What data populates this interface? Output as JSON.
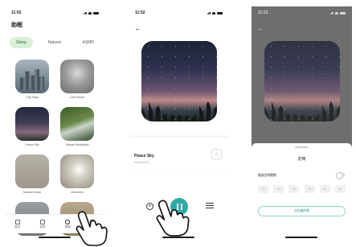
{
  "status": {
    "time": "11:52"
  },
  "screen1": {
    "title": "助眠",
    "tabs": [
      "Sleep",
      "Natural",
      "ASMR"
    ],
    "items": [
      {
        "caption": "City Stray"
      },
      {
        "caption": "Lost Dream"
      },
      {
        "caption": "Peace Sky"
      },
      {
        "caption": "Stream Meditation"
      },
      {
        "caption": "Natural Grass"
      },
      {
        "caption": "Memories"
      },
      {
        "caption": ""
      },
      {
        "caption": ""
      }
    ],
    "nav": [
      "首页",
      "发现",
      "助眠",
      "我的"
    ]
  },
  "screen2": {
    "back_icon": "←",
    "track_title": "Peace Sky",
    "track_sub": "00:01/00:10",
    "star_icon": "☆"
  },
  "screen3": {
    "sheet_title": "定時",
    "switch_label": "播放定時關閉",
    "minutes": [
      "10",
      "20",
      "30",
      "45",
      "60",
      "90"
    ],
    "custom_label": "自定義時間"
  },
  "colors": {
    "accent": "#2eaaa6",
    "tab_active_bg": "#d9efd6",
    "overlay": "#6e6e6e"
  }
}
